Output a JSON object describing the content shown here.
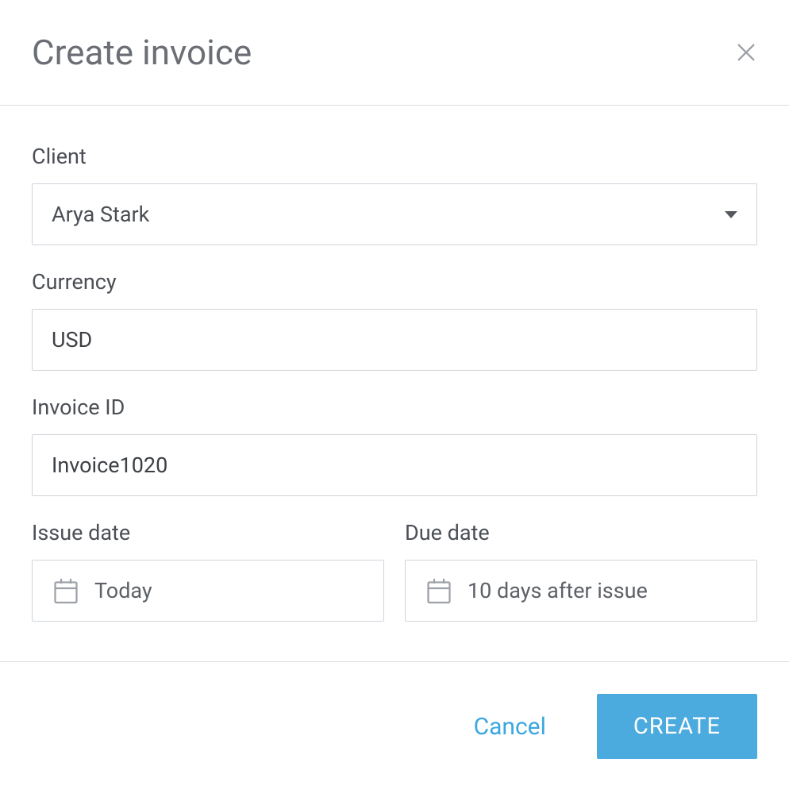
{
  "dialog": {
    "title": "Create invoice"
  },
  "fields": {
    "client": {
      "label": "Client",
      "value": "Arya Stark"
    },
    "currency": {
      "label": "Currency",
      "value": "USD"
    },
    "invoice_id": {
      "label": "Invoice ID",
      "value": "Invoice1020"
    },
    "issue_date": {
      "label": "Issue date",
      "value": "Today"
    },
    "due_date": {
      "label": "Due date",
      "value": "10 days after issue"
    }
  },
  "footer": {
    "cancel_label": "Cancel",
    "create_label": "CREATE"
  }
}
